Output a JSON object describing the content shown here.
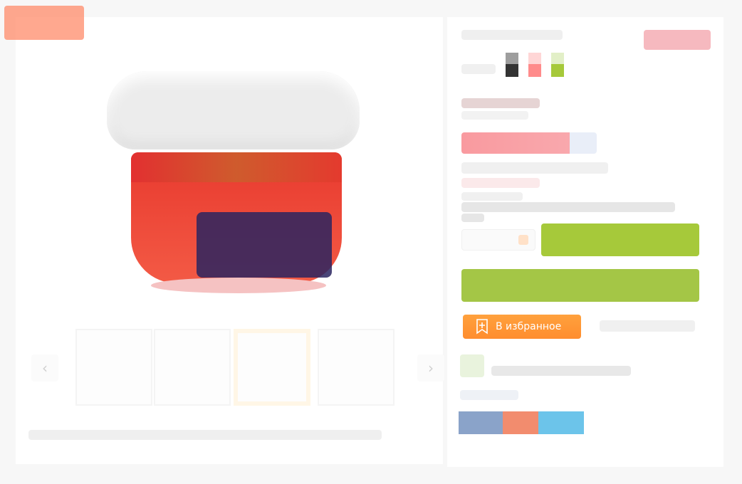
{
  "badges": {
    "sale": ""
  },
  "product": {
    "image_icon": "product-cup-image",
    "caption": ""
  },
  "gallery": {
    "prev_icon": "chevron-left-icon",
    "next_icon": "chevron-right-icon",
    "thumb_count": 4,
    "active_index": 2
  },
  "colors": {
    "accent_orange": "#ff8d2e",
    "accent_green": "#a6c93a",
    "sale_pink": "#f6b9bf",
    "swatches": [
      "#9e9e9e",
      "#333333",
      "#ff8b8b",
      "#a6c93a",
      "#e6e6e6"
    ]
  },
  "actions": {
    "favorite_label": "В избранное",
    "favorite_icon": "bookmark-plus-icon",
    "add_to_cart_label": "",
    "buy_one_click_label": ""
  },
  "share": {
    "icons": [
      "vk-icon",
      "ok-icon",
      "telegram-icon",
      "twitter-icon"
    ]
  }
}
